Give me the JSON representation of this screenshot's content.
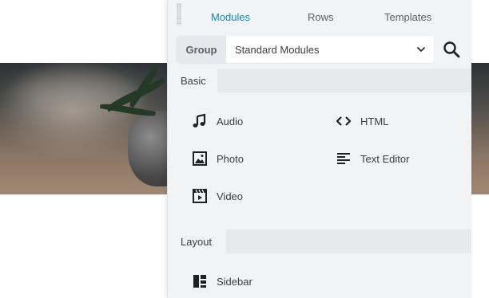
{
  "panel": {
    "tabs": [
      {
        "label": "Modules",
        "active": true
      },
      {
        "label": "Rows",
        "active": false
      },
      {
        "label": "Templates",
        "active": false
      }
    ],
    "group": {
      "label": "Group",
      "selected": "Standard Modules"
    },
    "sections": [
      {
        "title": "Basic",
        "modules": [
          {
            "label": "Audio",
            "icon": "music-note-icon"
          },
          {
            "label": "HTML",
            "icon": "code-icon"
          },
          {
            "label": "Photo",
            "icon": "image-icon"
          },
          {
            "label": "Text Editor",
            "icon": "text-align-icon"
          },
          {
            "label": "Video",
            "icon": "video-clapper-icon"
          }
        ]
      },
      {
        "title": "Layout",
        "modules": [
          {
            "label": "Sidebar",
            "icon": "sidebar-layout-icon"
          }
        ]
      }
    ]
  },
  "colors": {
    "accent": "#0e8cba",
    "panel_bg": "#f2f3f5",
    "section_bar": "#e7e9ec"
  }
}
